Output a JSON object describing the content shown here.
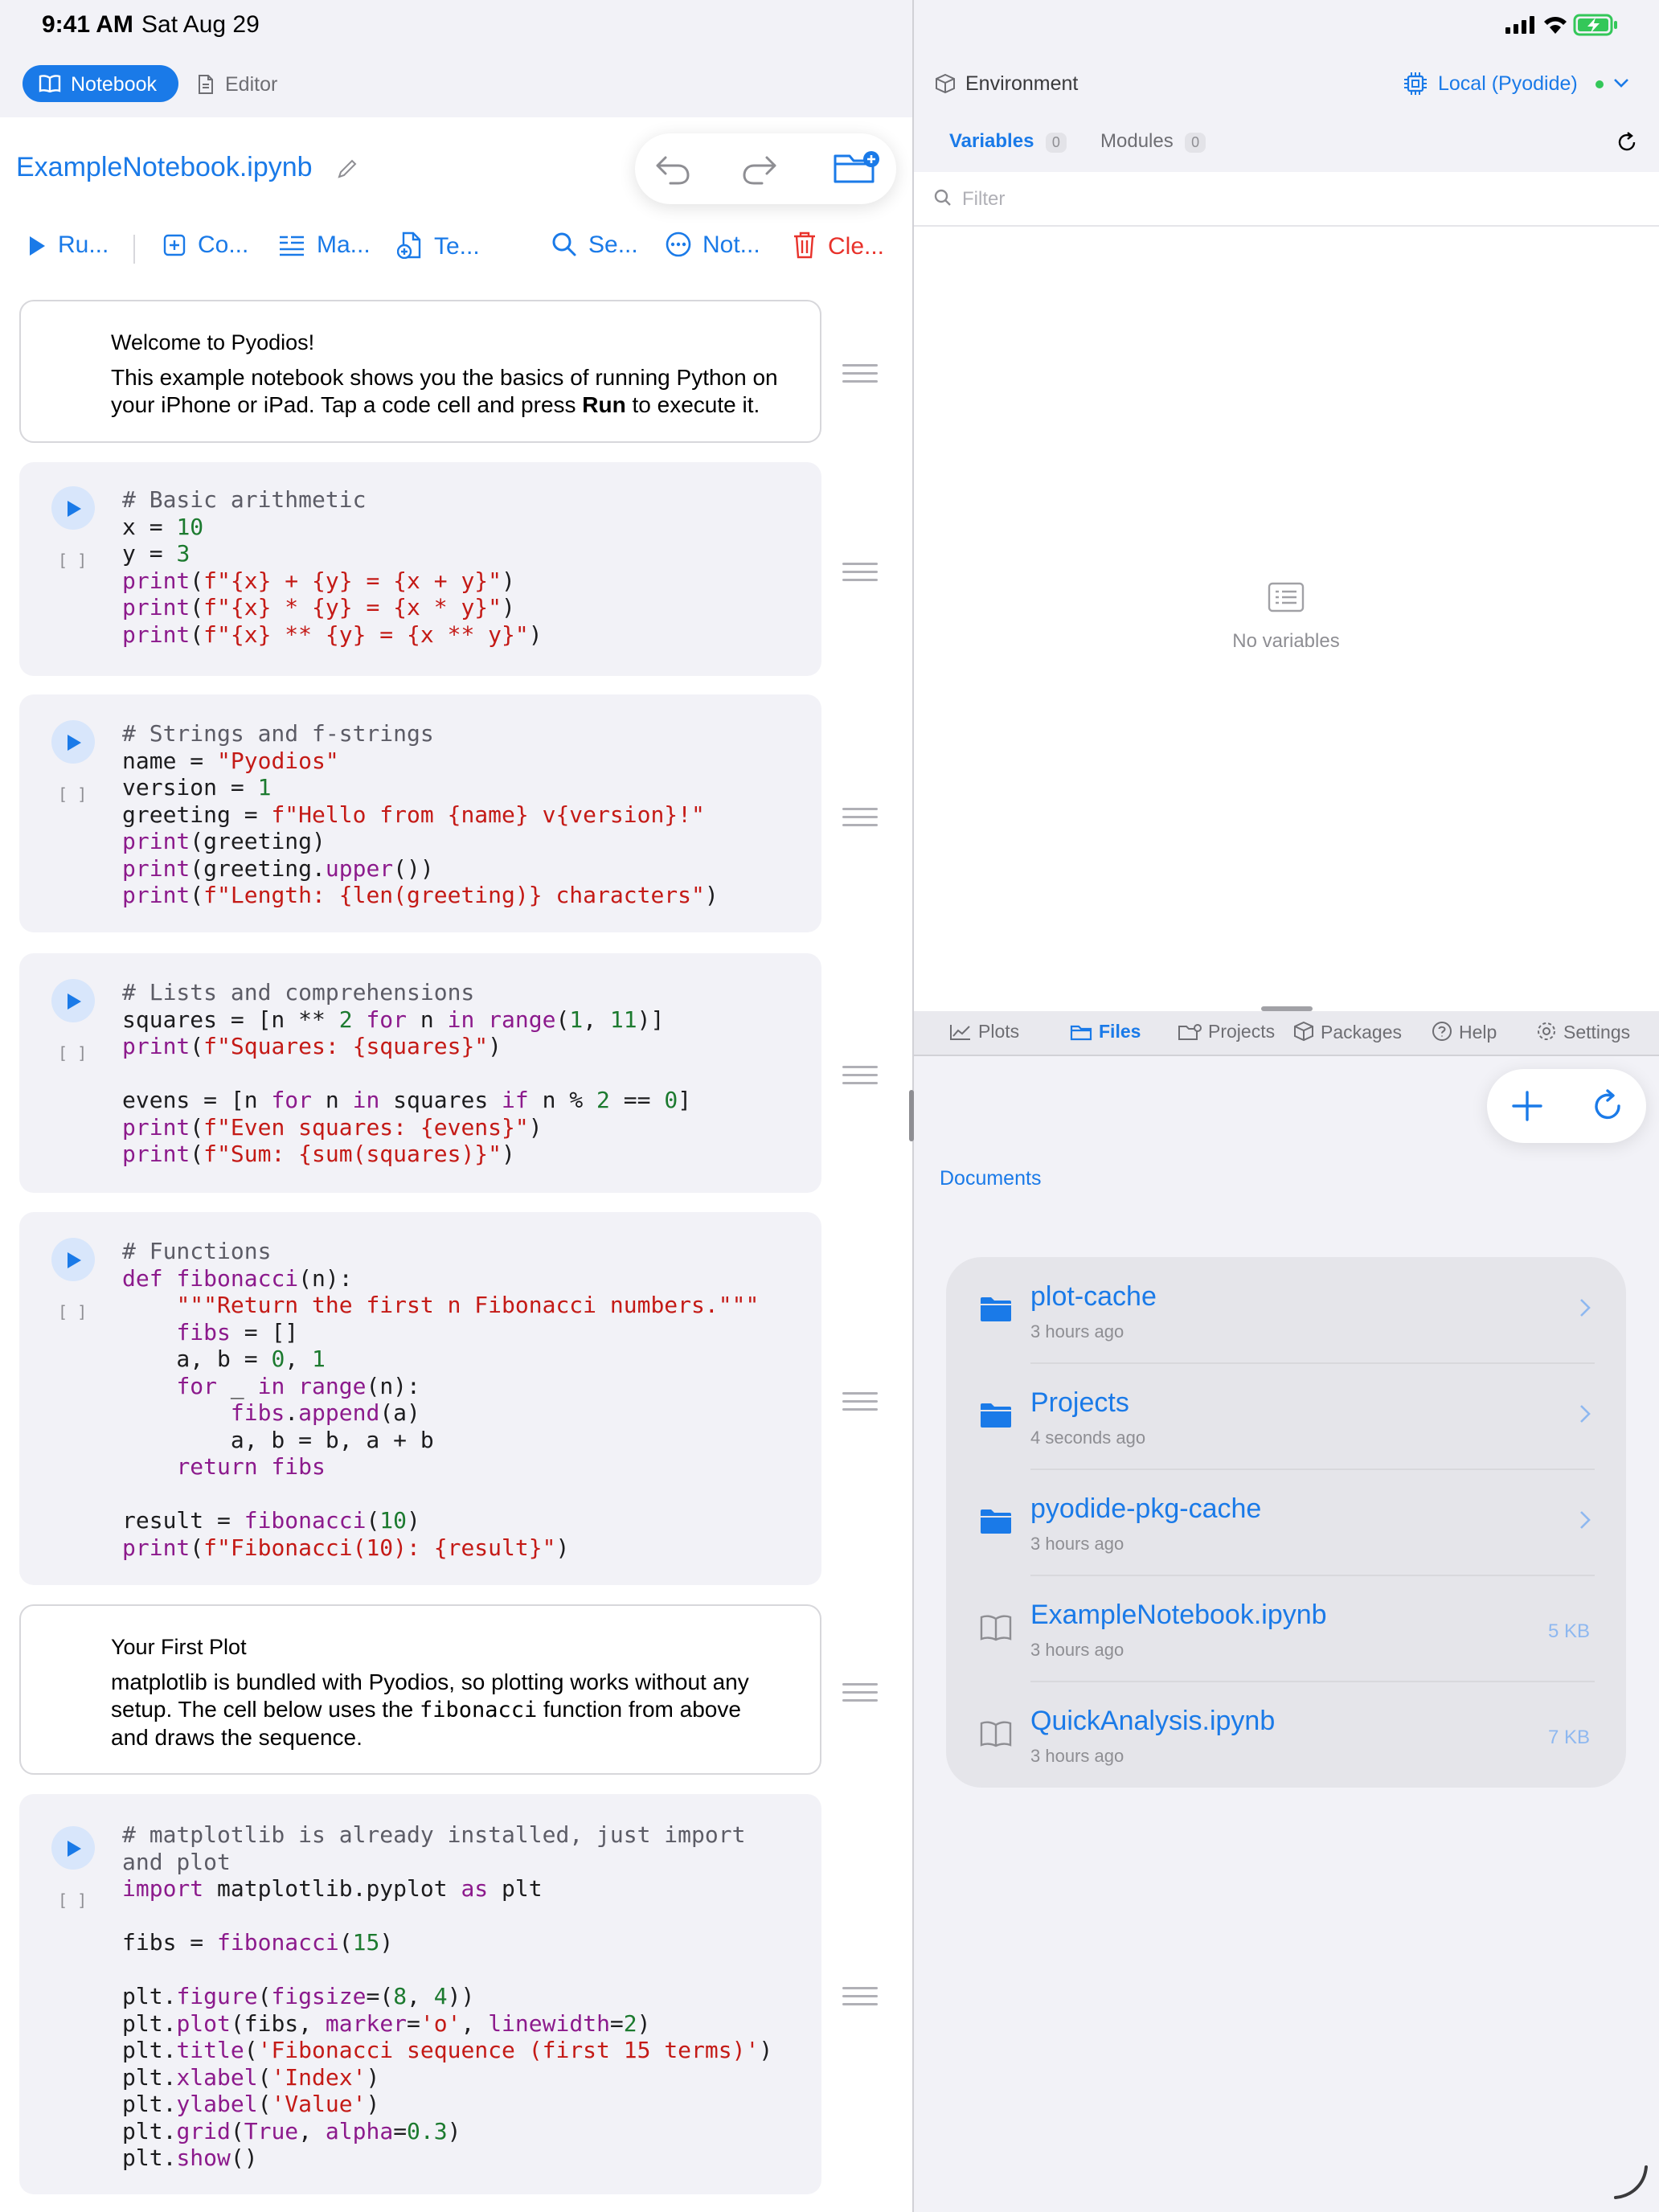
{
  "status": {
    "time": "9:41 AM",
    "date": "Sat Aug 29"
  },
  "modes": {
    "notebook": "Notebook",
    "editor": "Editor"
  },
  "notebook": {
    "title": "ExampleNotebook.ipynb"
  },
  "toolbar": {
    "run": "Ru...",
    "code": "Co...",
    "markdown": "Ma...",
    "template": "Te...",
    "search": "Se...",
    "notebook": "Not...",
    "clear": "Cle..."
  },
  "cells": {
    "md1": {
      "title": "Welcome to Pyodios!",
      "line1": "This example notebook shows you the basics of running Python on",
      "line2_pre": "your iPhone or iPad. Tap a code cell and press ",
      "line2_bold": "Run",
      "line2_post": " to execute it."
    },
    "exec_count": "[ ]",
    "md2": {
      "title": "Your First Plot",
      "line1": "matplotlib is bundled with Pyodios, so plotting works without any",
      "line2_pre": "setup. The cell below uses the ",
      "line2_code": "fibonacci",
      "line2_post": " function from above",
      "line3": "and draws the sequence."
    }
  },
  "environment": {
    "title": "Environment",
    "runtime": "Local (Pyodide)",
    "tabs": {
      "variables": "Variables",
      "variables_count": "0",
      "modules": "Modules",
      "modules_count": "0"
    },
    "filter_placeholder": "Filter",
    "empty": "No variables"
  },
  "bottom_tabs": {
    "plots": "Plots",
    "files": "Files",
    "projects": "Projects",
    "packages": "Packages",
    "help": "Help",
    "settings": "Settings"
  },
  "files": {
    "location": "Documents",
    "items": [
      {
        "name": "plot-cache",
        "date": "3 hours ago",
        "size": "",
        "kind": "folder"
      },
      {
        "name": "Projects",
        "date": "4 seconds ago",
        "size": "",
        "kind": "folder"
      },
      {
        "name": "pyodide-pkg-cache",
        "date": "3 hours ago",
        "size": "",
        "kind": "folder"
      },
      {
        "name": "ExampleNotebook.ipynb",
        "date": "3 hours ago",
        "size": "5 KB",
        "kind": "notebook"
      },
      {
        "name": "QuickAnalysis.ipynb",
        "date": "3 hours ago",
        "size": "7 KB",
        "kind": "notebook"
      }
    ]
  },
  "colors": {
    "accent": "#1a7ae8",
    "destructive": "#e8322b",
    "string": "#c41a16",
    "keyword": "#8c1a8c",
    "number": "#1c7a2f",
    "status_green": "#34c759"
  }
}
